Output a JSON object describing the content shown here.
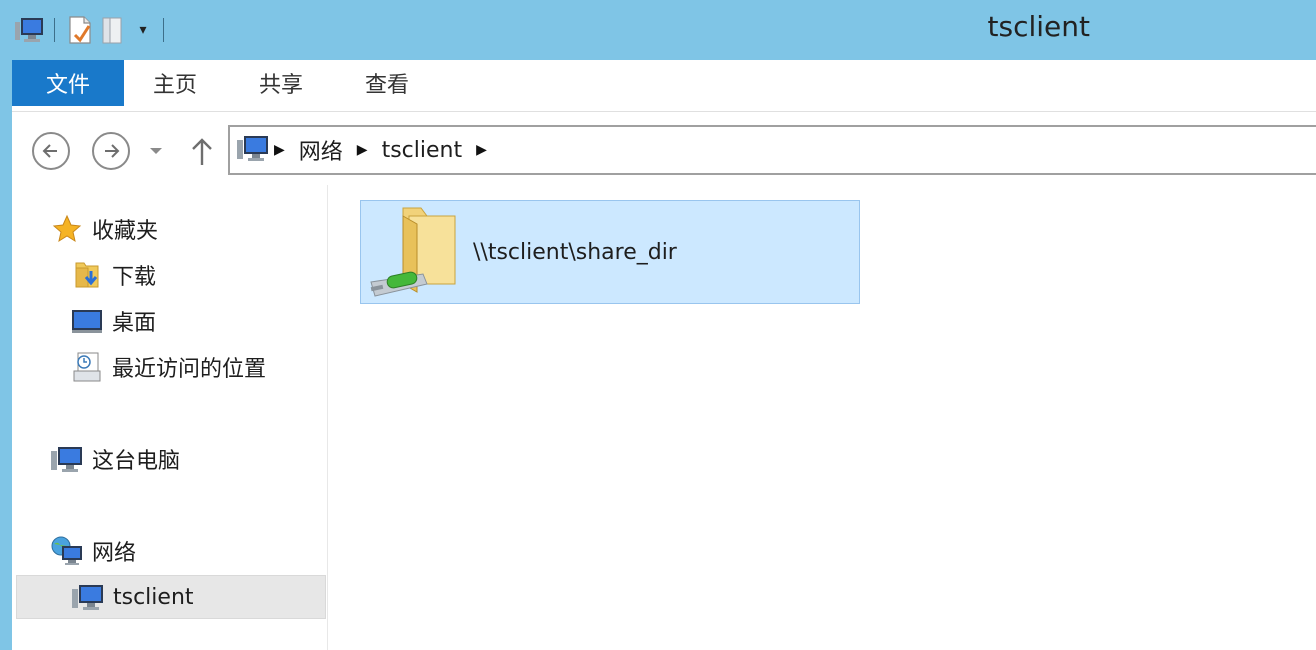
{
  "window": {
    "title": "tsclient"
  },
  "quick_access": {
    "icons": [
      "computer-icon",
      "properties-icon",
      "new-folder-icon"
    ],
    "customize_label": "▾"
  },
  "ribbon": {
    "tabs": [
      {
        "label": "文件",
        "active": true
      },
      {
        "label": "主页"
      },
      {
        "label": "共享"
      },
      {
        "label": "查看"
      }
    ]
  },
  "address_bar": {
    "segments": [
      "网络",
      "tsclient"
    ]
  },
  "sidebar": {
    "favorites": {
      "label": "收藏夹",
      "items": [
        {
          "label": "下载",
          "icon": "downloads-icon"
        },
        {
          "label": "桌面",
          "icon": "desktop-icon"
        },
        {
          "label": "最近访问的位置",
          "icon": "recent-places-icon"
        }
      ]
    },
    "this_pc": {
      "label": "这台电脑",
      "icon": "computer-icon"
    },
    "network": {
      "label": "网络",
      "icon": "network-icon",
      "children": [
        {
          "label": "tsclient",
          "icon": "computer-icon",
          "selected": true
        }
      ]
    }
  },
  "content": {
    "items": [
      {
        "label": "\\\\tsclient\\share_dir",
        "icon": "network-share-folder-icon",
        "selected": true
      }
    ]
  },
  "colors": {
    "titlebar": "#7fc5e6",
    "file_tab": "#1979ca",
    "selection": "#cce8ff",
    "selection_border": "#99c5ee"
  }
}
